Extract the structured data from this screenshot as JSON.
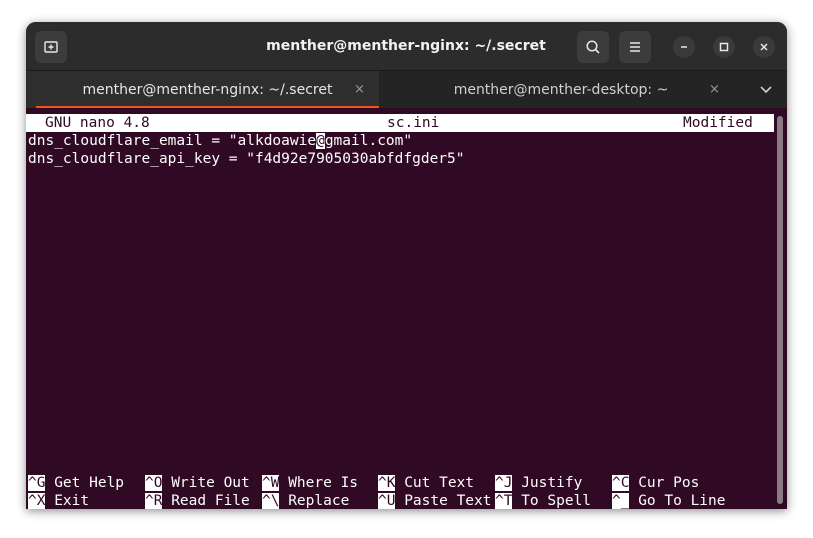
{
  "window": {
    "title": "menther@menther-nginx: ~/.secret"
  },
  "tabs": [
    {
      "label": "menther@menther-nginx: ~/.secret",
      "active": true
    },
    {
      "label": "menther@menther-desktop: ~",
      "active": false
    }
  ],
  "icons": {
    "new_tab": "new-tab-icon",
    "search": "search-icon",
    "menu": "hamburger-menu-icon",
    "minimize": "minimize-icon",
    "maximize": "maximize-icon",
    "close": "close-icon",
    "tab_close": "×",
    "tab_list": "chevron-down-icon"
  },
  "nano": {
    "version": "GNU nano 4.8",
    "filename": "sc.ini",
    "state": "Modified",
    "line1_before_cursor": "dns_cloudflare_email = \"alkdoawie",
    "line1_cursor_char": "@",
    "line1_after_cursor": "gmail.com\"",
    "line2": "dns_cloudflare_api_key = \"f4d92e7905030abfdfgder5\"",
    "shortcuts_row1": [
      {
        "key": "^G",
        "label": " Get Help"
      },
      {
        "key": "^O",
        "label": " Write Out"
      },
      {
        "key": "^W",
        "label": " Where Is"
      },
      {
        "key": "^K",
        "label": " Cut Text"
      },
      {
        "key": "^J",
        "label": " Justify"
      },
      {
        "key": "^C",
        "label": " Cur Pos"
      }
    ],
    "shortcuts_row2": [
      {
        "key": "^X",
        "label": " Exit"
      },
      {
        "key": "^R",
        "label": " Read File"
      },
      {
        "key": "^\\",
        "label": " Replace"
      },
      {
        "key": "^U",
        "label": " Paste Text"
      },
      {
        "key": "^T",
        "label": " To Spell"
      },
      {
        "key": "^_",
        "label": " Go To Line"
      }
    ]
  },
  "colors": {
    "terminal_bg": "#300a24",
    "accent": "#e95420",
    "header_bg": "#2c2c2c"
  }
}
